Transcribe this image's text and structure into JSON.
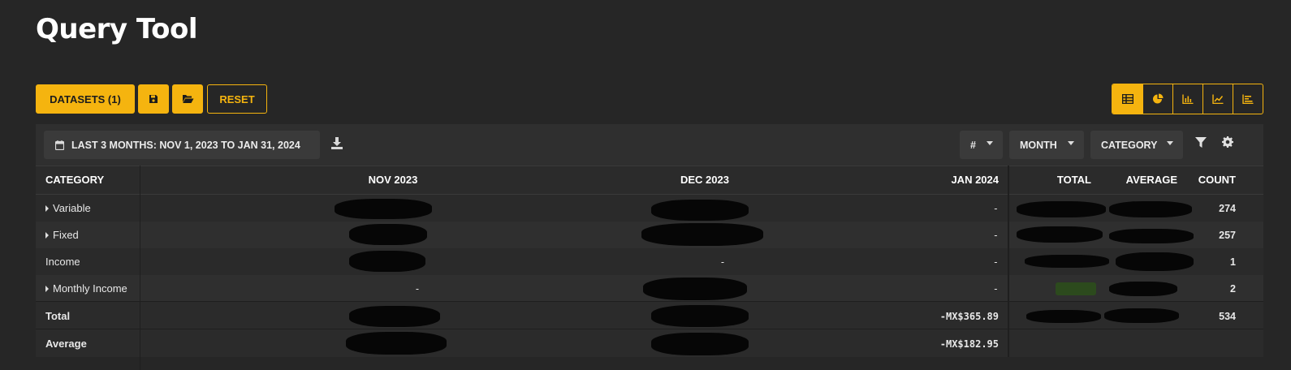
{
  "page": {
    "title": "Query Tool"
  },
  "toolbar": {
    "datasets_label": "DATASETS (1)",
    "reset_label": "RESET",
    "save_icon": "save-icon",
    "open_icon": "folder-open-icon"
  },
  "view_modes": {
    "active": "table",
    "items": [
      "table",
      "pie",
      "bar",
      "line",
      "horizontal-bar"
    ]
  },
  "filters": {
    "date_range": "LAST 3 MONTHS: NOV 1, 2023 TO JAN 31, 2024",
    "value_type": "#",
    "group_by_time": "MONTH",
    "group_by": "CATEGORY"
  },
  "table": {
    "headers": {
      "category": "CATEGORY",
      "months": [
        "NOV 2023",
        "DEC 2023",
        "JAN 2024"
      ],
      "total": "TOTAL",
      "average": "AVERAGE",
      "count": "COUNT"
    },
    "rows": [
      {
        "label": "Variable",
        "expandable": true,
        "nov": "",
        "dec": "",
        "jan": "-",
        "total": "",
        "average": "",
        "count": "274"
      },
      {
        "label": "Fixed",
        "expandable": true,
        "nov": "",
        "dec": "",
        "jan": "-",
        "total": "",
        "average": "",
        "count": "257"
      },
      {
        "label": "Income",
        "expandable": false,
        "nov": "",
        "dec": "-",
        "jan": "-",
        "total": "",
        "average": "",
        "count": "1"
      },
      {
        "label": "Monthly Income",
        "expandable": true,
        "nov": "-",
        "dec": "",
        "jan": "-",
        "total": "",
        "average": "",
        "count": "2"
      }
    ],
    "total_row": {
      "label": "Total",
      "jan": "-MX$365.89",
      "count": "534"
    },
    "average_row": {
      "label": "Average",
      "jan": "-MX$182.95"
    }
  },
  "colors": {
    "accent": "#f5b40f",
    "positive": "#5cbf2a",
    "background": "#262626",
    "panel": "#2f2f2f"
  }
}
